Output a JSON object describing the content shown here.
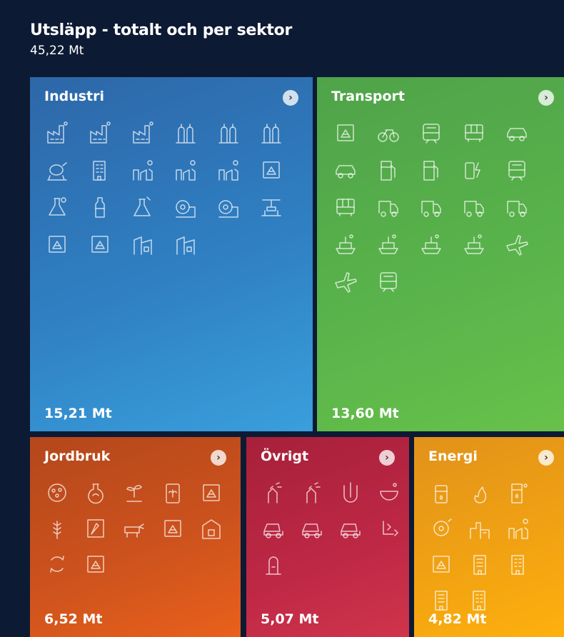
{
  "header": {
    "title": "Utsläpp - totalt och per sektor",
    "total": "45,22 Mt"
  },
  "colors": {
    "background": "#0d1a33",
    "industri": "#2f80c3",
    "transport": "#5ab44b",
    "jordbruk": "#cc521d",
    "ovrigt": "#be2845",
    "energi": "#f2a312"
  },
  "sectors": [
    {
      "name": "Industri",
      "value": "15,21 Mt",
      "arrow": "›",
      "icons": [
        "factory-icon",
        "factory-icon",
        "factory-icon",
        "gas-tank-icon",
        "gas-tank-icon",
        "gas-tank-icon",
        "cement-mixer-icon",
        "building-icon",
        "chemical-plant-icon",
        "chemical-plant-icon",
        "chemical-plant-icon",
        "emission-box-icon",
        "lab-flask-icon",
        "bottle-icon",
        "chemical-flask-icon",
        "paper-roll-icon",
        "paper-roll-icon",
        "press-icon",
        "emission-box-icon",
        "emission-box-icon",
        "warehouse-icon",
        "warehouse-icon"
      ]
    },
    {
      "name": "Transport",
      "value": "13,60 Mt",
      "arrow": "›",
      "icons": [
        "emission-box-icon",
        "bicycle-icon",
        "train-icon",
        "bus-icon",
        "car-icon",
        "car-icon",
        "fuel-icon",
        "fuel-icon",
        "electric-car-icon",
        "train-icon",
        "bus-icon",
        "truck-icon",
        "truck-icon",
        "truck-icon",
        "truck-icon",
        "ship-icon",
        "ship-icon",
        "ship-icon",
        "ship-icon",
        "airplane-icon",
        "airplane-icon",
        "train-icon"
      ]
    },
    {
      "name": "Jordbruk",
      "value": "6,52 Mt",
      "arrow": "›",
      "icons": [
        "fertilizer-icon",
        "flask-icon",
        "sprout-icon",
        "seed-bag-icon",
        "emission-box-icon",
        "grain-icon",
        "carrot-icon",
        "cow-icon",
        "emission-box-icon",
        "greenhouse-icon",
        "compost-icon",
        "emission-box-icon"
      ]
    },
    {
      "name": "Övrigt",
      "value": "5,07 Mt",
      "arrow": "›",
      "icons": [
        "spray-can-icon",
        "spray-can-icon",
        "waste-water-icon",
        "bowl-icon",
        "dump-truck-icon",
        "dump-truck-icon",
        "dump-truck-icon",
        "waste-process-icon",
        "machine-icon"
      ]
    },
    {
      "name": "Energi",
      "value": "4,82 Mt",
      "arrow": "›",
      "icons": [
        "oil-drum-icon",
        "flame-icon",
        "fuel-pump-icon",
        "turbine-icon",
        "power-plant-icon",
        "chemical-plant-icon",
        "emission-box-icon",
        "office-building-icon",
        "building-icon",
        "office-building-icon",
        "building-icon"
      ]
    }
  ]
}
